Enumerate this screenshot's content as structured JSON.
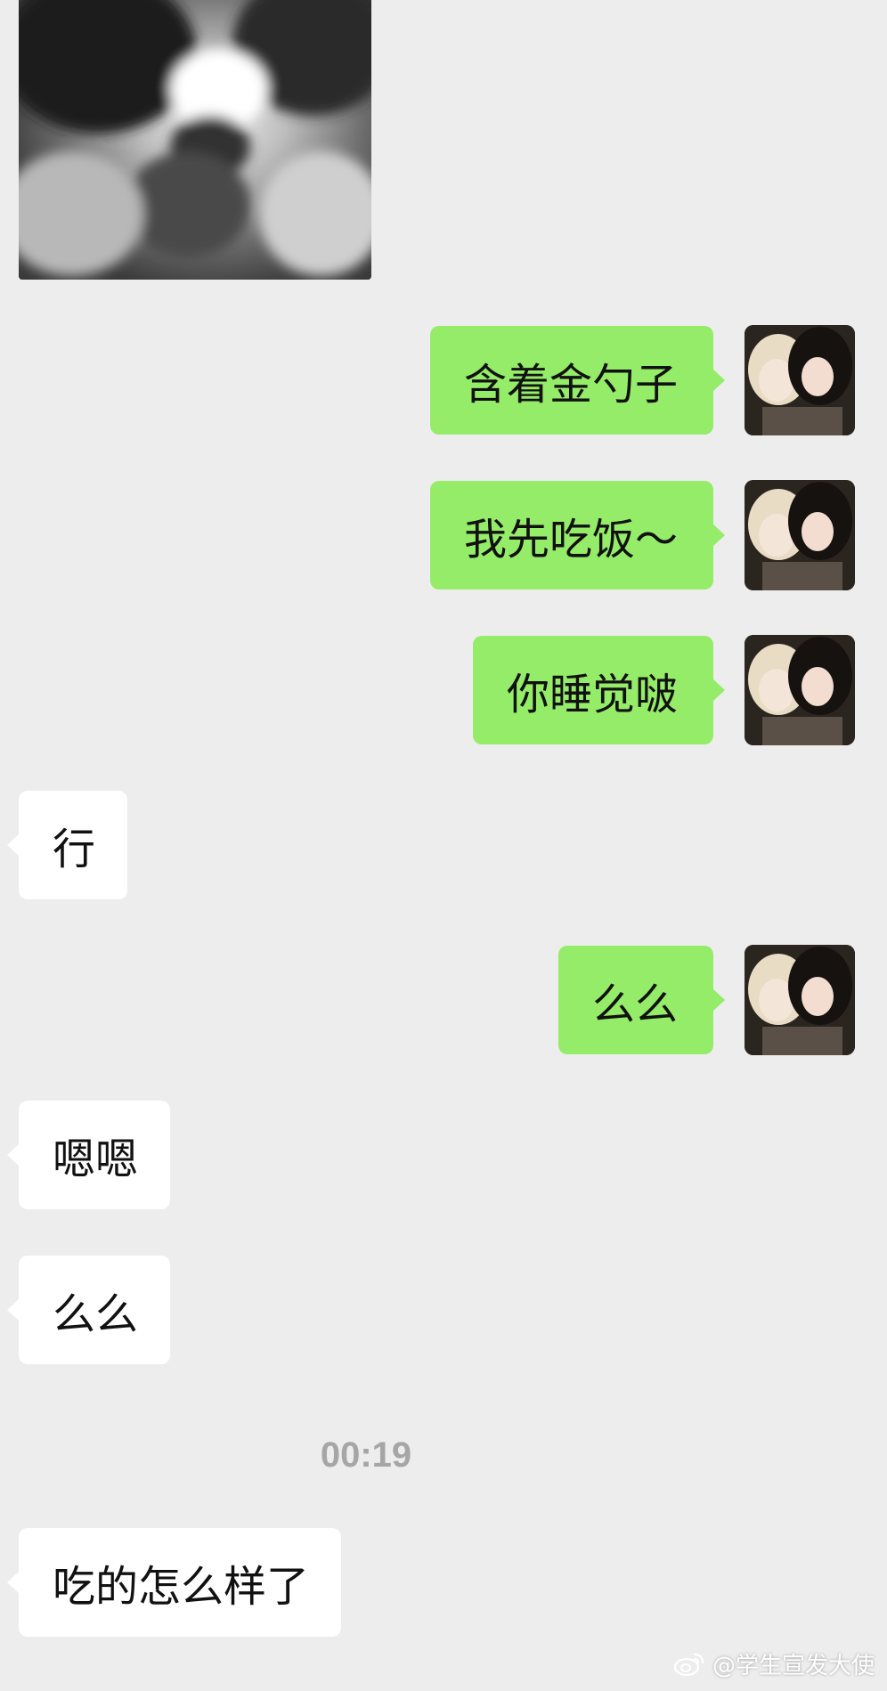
{
  "chat": {
    "image_message": {
      "icon": "cat-photo"
    },
    "messages": [
      {
        "side": "out",
        "text": "含着金勺子"
      },
      {
        "side": "out",
        "text": "我先吃饭～"
      },
      {
        "side": "out",
        "text": "你睡觉啵"
      },
      {
        "side": "in",
        "text": "行"
      },
      {
        "side": "out",
        "text": "么么"
      },
      {
        "side": "in",
        "text": "嗯嗯"
      },
      {
        "side": "in",
        "text": "么么"
      },
      {
        "side": "in",
        "text": "吃的怎么样了"
      }
    ],
    "timestamp": "00:19"
  },
  "watermark": {
    "text": "@学生宣发大使",
    "icon": "weibo-logo-icon"
  },
  "colors": {
    "background": "#ededed",
    "outgoing_bubble": "#95ec69",
    "incoming_bubble": "#ffffff",
    "timestamp": "#a6a6a6"
  }
}
